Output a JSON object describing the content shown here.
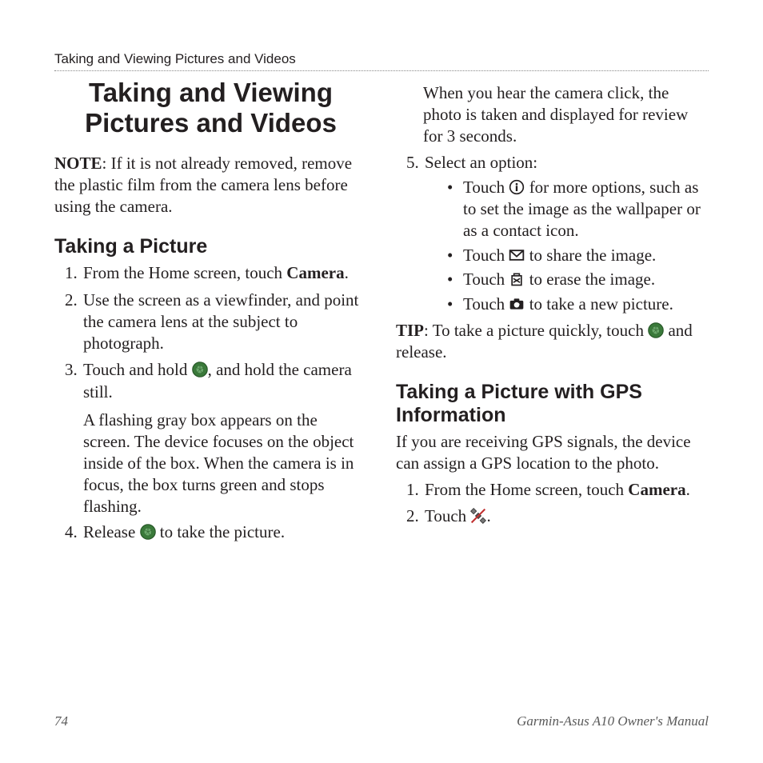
{
  "header": {
    "running": "Taking and Viewing Pictures and Videos"
  },
  "chapter_title": "Taking and Viewing Pictures and Videos",
  "note_label": "NOTE",
  "note_body": ": If it is not already removed, remove the plastic film from the camera lens before using the camera.",
  "section1": {
    "title": "Taking a Picture",
    "step1_pre": "From the Home screen, touch ",
    "step1_bold": "Camera",
    "step1_post": ".",
    "step2": "Use the screen as a viewfinder, and point the camera lens at the subject to photograph.",
    "step3_pre": "Touch and hold ",
    "step3_post": ", and hold the camera still.",
    "step3_detail": "A flashing gray box appears on the screen. The device focuses on the object inside of the box. When the camera is in focus, the box turns green and stops flashing.",
    "step4_pre": "Release ",
    "step4_post": " to take the picture.",
    "step4_detail": "When you hear the camera click, the photo is taken and displayed for review for 3 seconds.",
    "step5_intro": "Select an option:",
    "opt1_pre": "Touch ",
    "opt1_post": " for more options, such as to set the image as the wallpaper or as a contact icon.",
    "opt2_pre": "Touch ",
    "opt2_post": " to share the image.",
    "opt3_pre": "Touch ",
    "opt3_post": " to erase the image.",
    "opt4_pre": "Touch ",
    "opt4_post": " to take a new picture."
  },
  "tip_label": "TIP",
  "tip_pre": ": To take a picture quickly, touch ",
  "tip_post": " and release.",
  "section2": {
    "title": "Taking a Picture with GPS Information",
    "intro": "If you are receiving GPS signals, the device can assign a GPS location to the photo.",
    "step1_pre": "From the Home screen, touch ",
    "step1_bold": "Camera",
    "step1_post": ".",
    "step2_pre": "Touch ",
    "step2_post": "."
  },
  "footer": {
    "page": "74",
    "manual": "Garmin-Asus A10 Owner's Manual"
  }
}
